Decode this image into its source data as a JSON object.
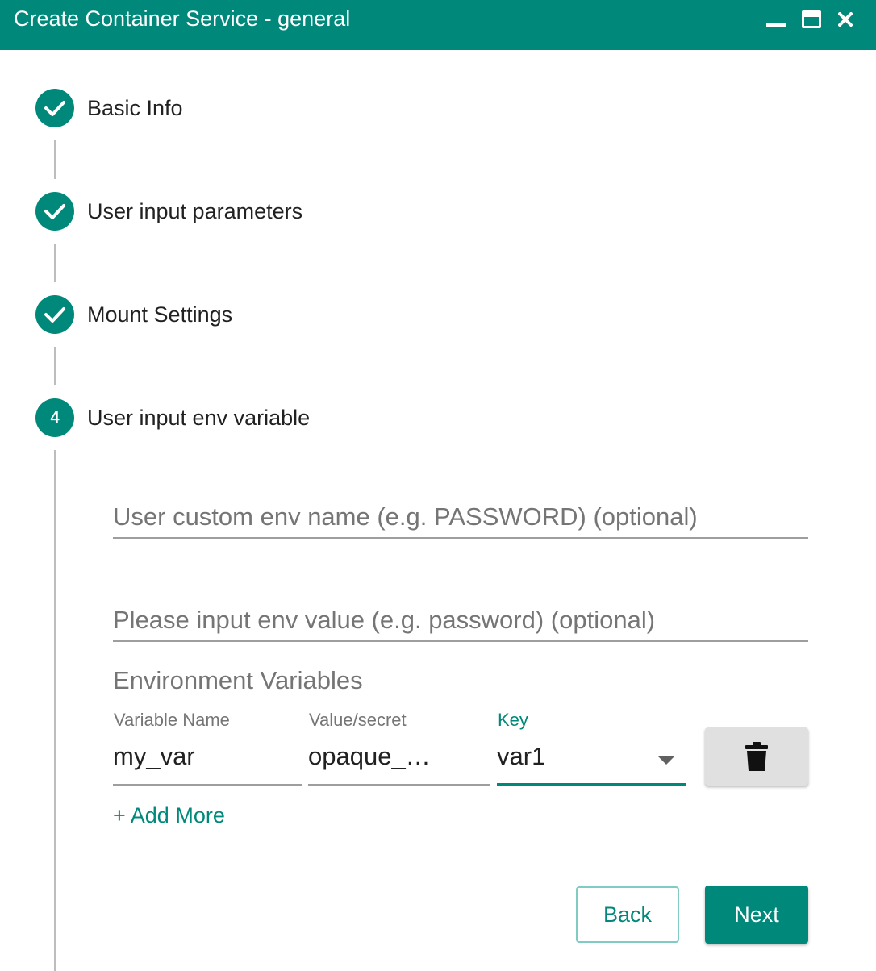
{
  "window": {
    "title": "Create Container Service - general",
    "accent_color": "#00897b",
    "controls": [
      "minimize-icon",
      "maximize-icon",
      "close-icon"
    ]
  },
  "steps": [
    {
      "label": "Basic Info",
      "status": "completed",
      "icon": "check-icon"
    },
    {
      "label": "User input parameters",
      "status": "completed",
      "icon": "check-icon"
    },
    {
      "label": "Mount Settings",
      "status": "completed",
      "icon": "check-icon"
    },
    {
      "label": "User input env variable",
      "status": "active",
      "number": "4"
    }
  ],
  "form": {
    "env_name": {
      "placeholder": "User custom env name (e.g. PASSWORD) (optional)",
      "value": ""
    },
    "env_value": {
      "placeholder": "Please input env value (e.g. password) (optional)",
      "value": ""
    },
    "env_section_title": "Environment Variables",
    "columns": {
      "name": "Variable Name",
      "value": "Value/secret",
      "key": "Key"
    },
    "rows": [
      {
        "name": "my_var",
        "value": "opaque_…",
        "key": "var1"
      }
    ],
    "delete_icon": "trash-icon",
    "add_more": "+ Add More"
  },
  "actions": {
    "back": "Back",
    "next": "Next"
  }
}
